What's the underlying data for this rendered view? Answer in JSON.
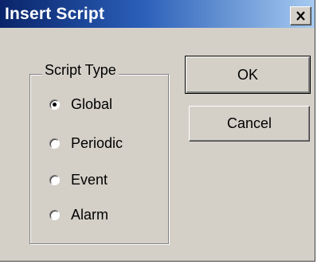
{
  "window": {
    "title": "Insert Script",
    "close_label": "X"
  },
  "script_type": {
    "legend": "Script Type",
    "selected": "Global",
    "options": [
      {
        "label": "Global",
        "checked": true
      },
      {
        "label": "Periodic",
        "checked": false
      },
      {
        "label": "Event",
        "checked": false
      },
      {
        "label": "Alarm",
        "checked": false
      }
    ]
  },
  "buttons": {
    "ok_label": "OK",
    "cancel_label": "Cancel"
  },
  "colors": {
    "face": "#d4d0c8",
    "title_start": "#0a246a",
    "title_end": "#a6caf0"
  }
}
